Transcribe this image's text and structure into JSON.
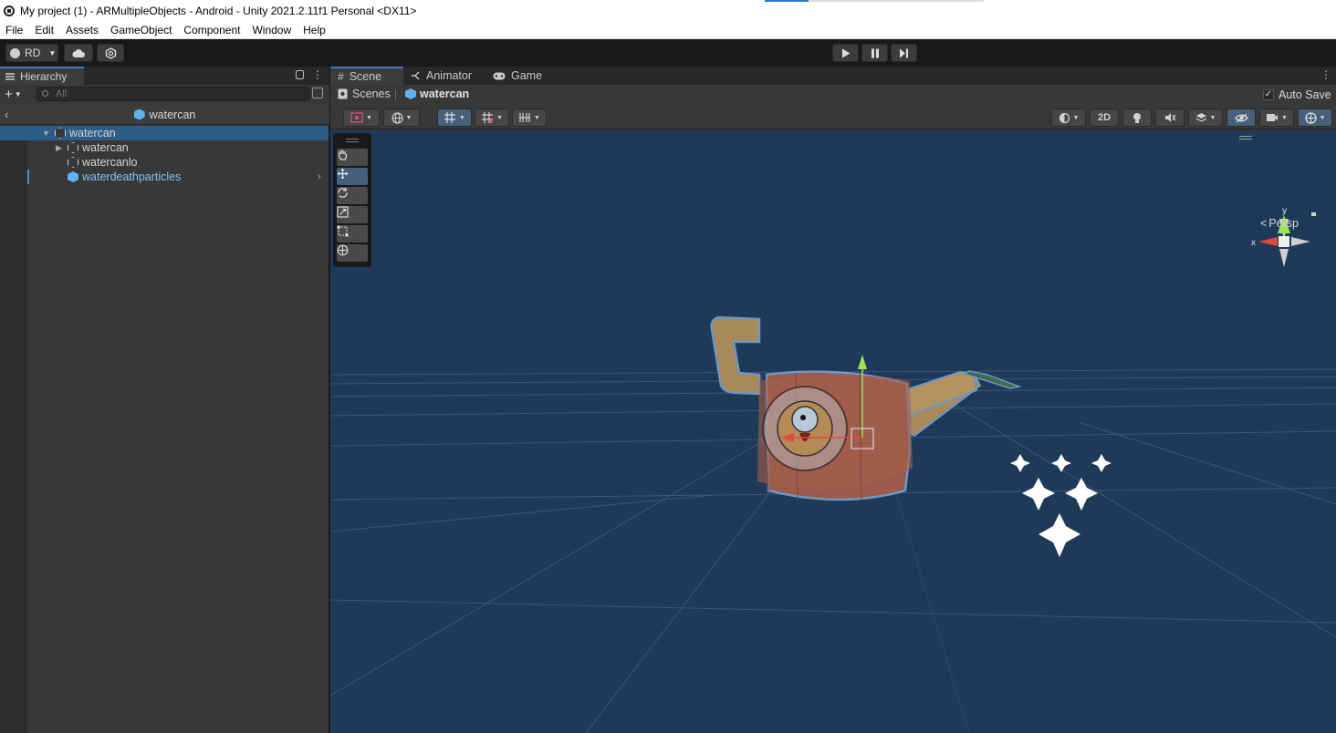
{
  "window": {
    "title": "My project (1) - ARMultipleObjects - Android - Unity 2021.2.11f1 Personal <DX11>"
  },
  "menu": [
    "File",
    "Edit",
    "Assets",
    "GameObject",
    "Component",
    "Window",
    "Help"
  ],
  "toolbar": {
    "account_label": "RD",
    "icons": [
      "user-icon",
      "cloud-icon",
      "collab-icon",
      "play-icon",
      "pause-icon",
      "step-icon"
    ]
  },
  "hierarchy": {
    "tab_label": "Hierarchy",
    "search_placeholder": "All",
    "prefab_header": "watercan",
    "tree": [
      {
        "label": "watercan",
        "level": 0,
        "expanded": true,
        "selected": true,
        "icon": "cube-icon"
      },
      {
        "label": "watercan",
        "level": 1,
        "expanded": false,
        "icon": "cube-icon"
      },
      {
        "label": "watercanlo",
        "level": 1,
        "icon": "cube-icon"
      },
      {
        "label": "waterdeathparticles",
        "level": 1,
        "prefab": true,
        "icon": "prefab-icon"
      }
    ]
  },
  "scene": {
    "tabs": [
      "Scene",
      "Animator",
      "Game"
    ],
    "active_tab": "Scene",
    "breadcrumb": {
      "root": "Scenes",
      "item": "watercan"
    },
    "autosave_label": "Auto Save",
    "autosave_checked": true,
    "toolbar_2d_label": "2D",
    "gizmo": {
      "y_label": "y",
      "x_label": "x",
      "projection": "Persp"
    },
    "tools": [
      "hand-tool-icon",
      "move-tool-icon",
      "rotate-tool-icon",
      "scale-tool-icon",
      "rect-tool-icon",
      "transform-tool-icon"
    ],
    "active_tool": "move-tool-icon",
    "colors": {
      "sky": "#1e3a58",
      "selected_row": "#2c5d87",
      "accent": "#3a79bb"
    }
  }
}
